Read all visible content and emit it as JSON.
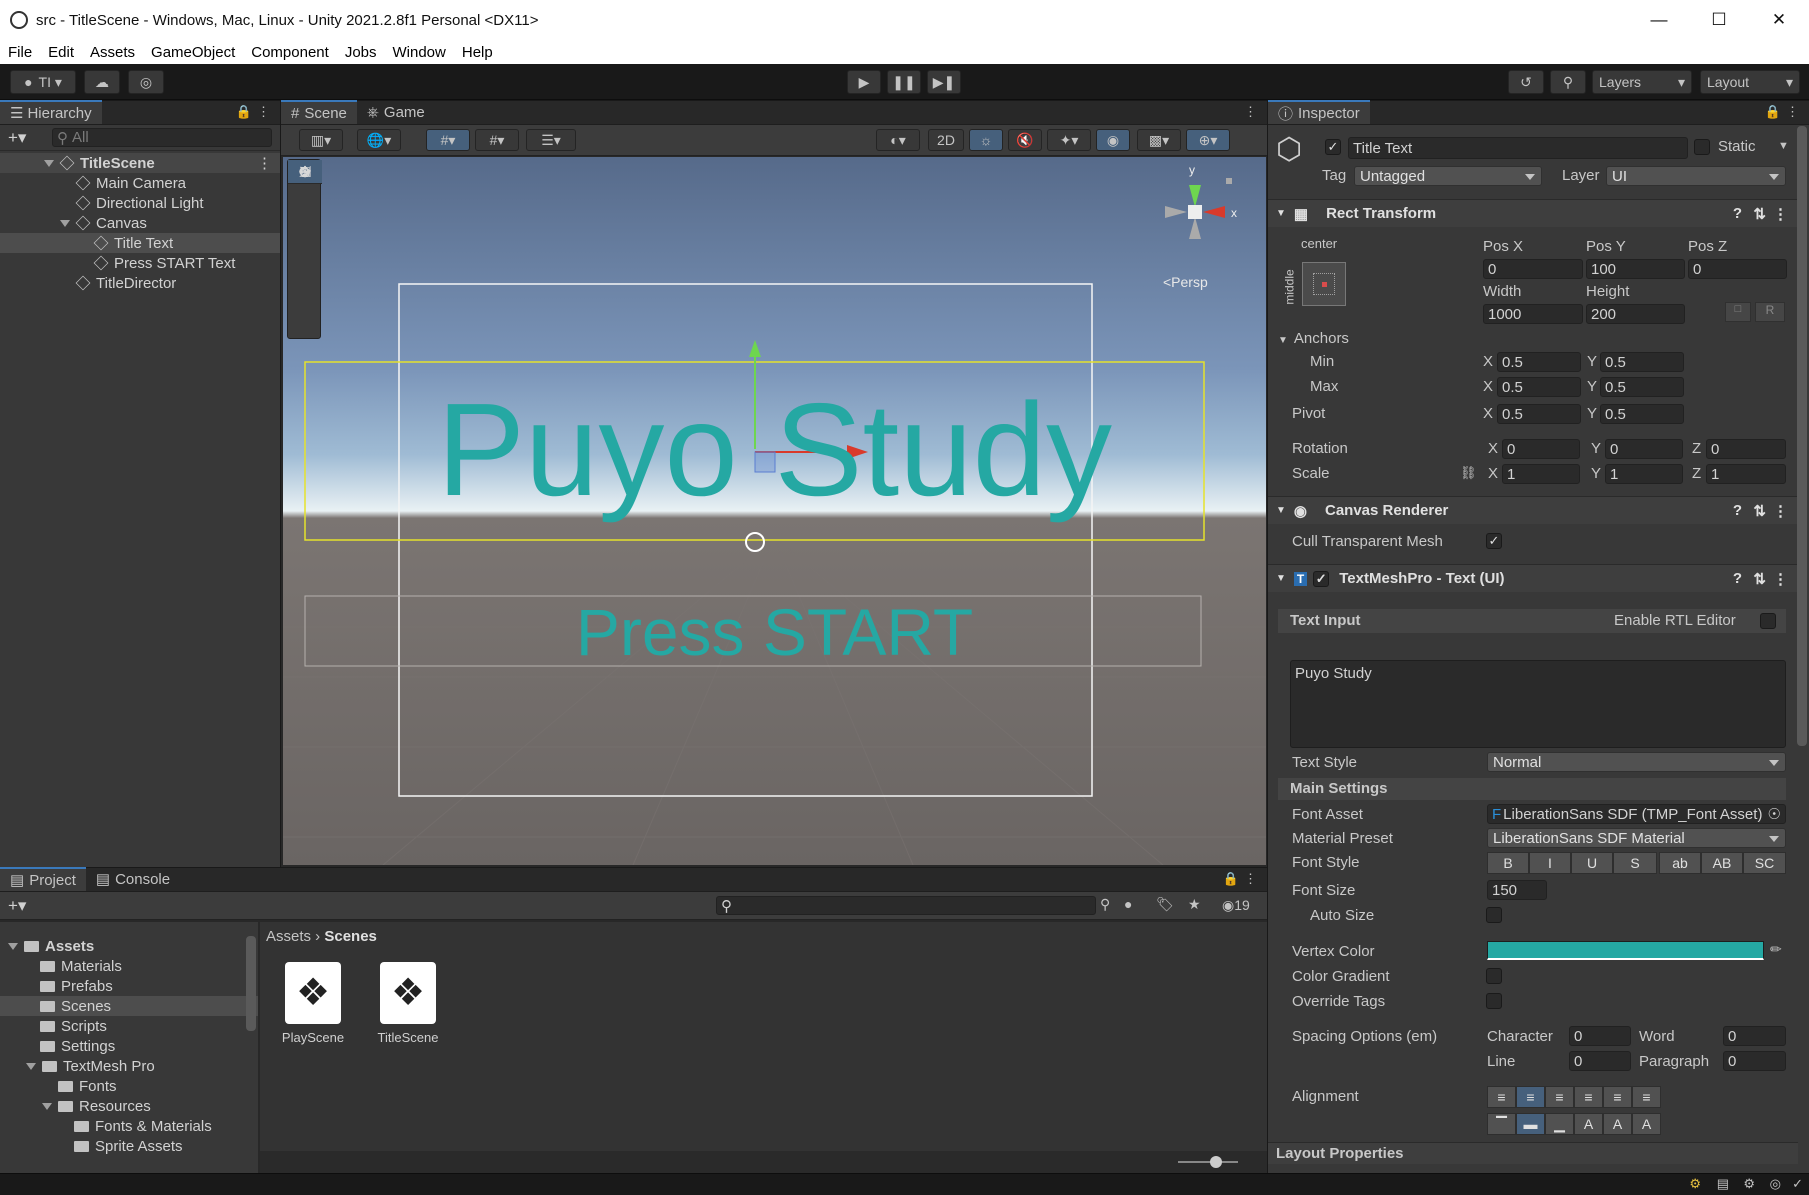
{
  "window": {
    "title": "src - TitleScene - Windows, Mac, Linux - Unity 2021.2.8f1 Personal <DX11>"
  },
  "menu": [
    "File",
    "Edit",
    "Assets",
    "GameObject",
    "Component",
    "Jobs",
    "Window",
    "Help"
  ],
  "toolbar": {
    "account": "TI",
    "layers": "Layers",
    "layout": "Layout"
  },
  "hierarchy": {
    "tab": "Hierarchy",
    "search_placeholder": "All",
    "items": [
      "TitleScene",
      "Main Camera",
      "Directional Light",
      "Canvas",
      "Title Text",
      "Press START Text",
      "TitleDirector"
    ]
  },
  "scene_view": {
    "tabs": [
      "Scene",
      "Game"
    ],
    "mode_2d": "2D",
    "persp_label": "<Persp",
    "axis_y": "y",
    "axis_x": "x",
    "title_text": "Puyo Study",
    "press_text": "Press START"
  },
  "project": {
    "tabs": [
      "Project",
      "Console"
    ],
    "hidden_count": "19",
    "breadcrumb": [
      "Assets",
      "Scenes"
    ],
    "tree": [
      "Assets",
      "Materials",
      "Prefabs",
      "Scenes",
      "Scripts",
      "Settings",
      "TextMesh Pro",
      "Fonts",
      "Resources",
      "Fonts & Materials",
      "Sprite Assets"
    ],
    "files": [
      "PlayScene",
      "TitleScene"
    ]
  },
  "inspector": {
    "tab": "Inspector",
    "object_name": "Title Text",
    "static_label": "Static",
    "tag_label": "Tag",
    "tag_value": "Untagged",
    "layer_label": "Layer",
    "layer_value": "UI",
    "rect": {
      "header": "Rect Transform",
      "anchor_h": "center",
      "anchor_v": "middle",
      "posx_label": "Pos X",
      "posy_label": "Pos Y",
      "posz_label": "Pos Z",
      "posx": "0",
      "posy": "100",
      "posz": "0",
      "width_label": "Width",
      "height_label": "Height",
      "width": "1000",
      "height": "200",
      "anchors_label": "Anchors",
      "min_label": "Min",
      "max_label": "Max",
      "pivot_label": "Pivot",
      "min_x": "0.5",
      "min_y": "0.5",
      "max_x": "0.5",
      "max_y": "0.5",
      "pivot_x": "0.5",
      "pivot_y": "0.5",
      "rotation_label": "Rotation",
      "scale_label": "Scale",
      "rot_x": "0",
      "rot_y": "0",
      "rot_z": "0",
      "scale_x": "1",
      "scale_y": "1",
      "scale_z": "1",
      "x": "X",
      "y": "Y",
      "z": "Z",
      "r_btn": "R"
    },
    "canvas_renderer": {
      "header": "Canvas Renderer",
      "cull_label": "Cull Transparent Mesh"
    },
    "tmp": {
      "header": "TextMeshPro - Text (UI)",
      "text_input_label": "Text Input",
      "rtl_label": "Enable RTL Editor",
      "text_value": "Puyo Study",
      "text_style_label": "Text Style",
      "text_style_value": "Normal",
      "main_settings": "Main Settings",
      "font_asset_label": "Font Asset",
      "font_asset_value": "LiberationSans SDF (TMP_Font Asset)",
      "material_label": "Material Preset",
      "material_value": "LiberationSans SDF Material",
      "font_style_label": "Font Style",
      "font_styles": [
        "B",
        "I",
        "U",
        "S",
        "ab",
        "AB",
        "SC"
      ],
      "font_size_label": "Font Size",
      "font_size_value": "150",
      "auto_size_label": "Auto Size",
      "vertex_color_label": "Vertex Color",
      "vertex_color": "#25a8a3",
      "color_gradient_label": "Color Gradient",
      "override_tags_label": "Override Tags",
      "spacing_label": "Spacing Options (em)",
      "character_label": "Character",
      "character_value": "0",
      "word_label": "Word",
      "word_value": "0",
      "line_label": "Line",
      "line_value": "0",
      "paragraph_label": "Paragraph",
      "paragraph_value": "0",
      "alignment_label": "Alignment",
      "layout_properties": "Layout Properties"
    }
  },
  "colors": {
    "accent": "#3a79bb",
    "text_teal": "#25a8a3",
    "selection": "#2c5d87"
  }
}
